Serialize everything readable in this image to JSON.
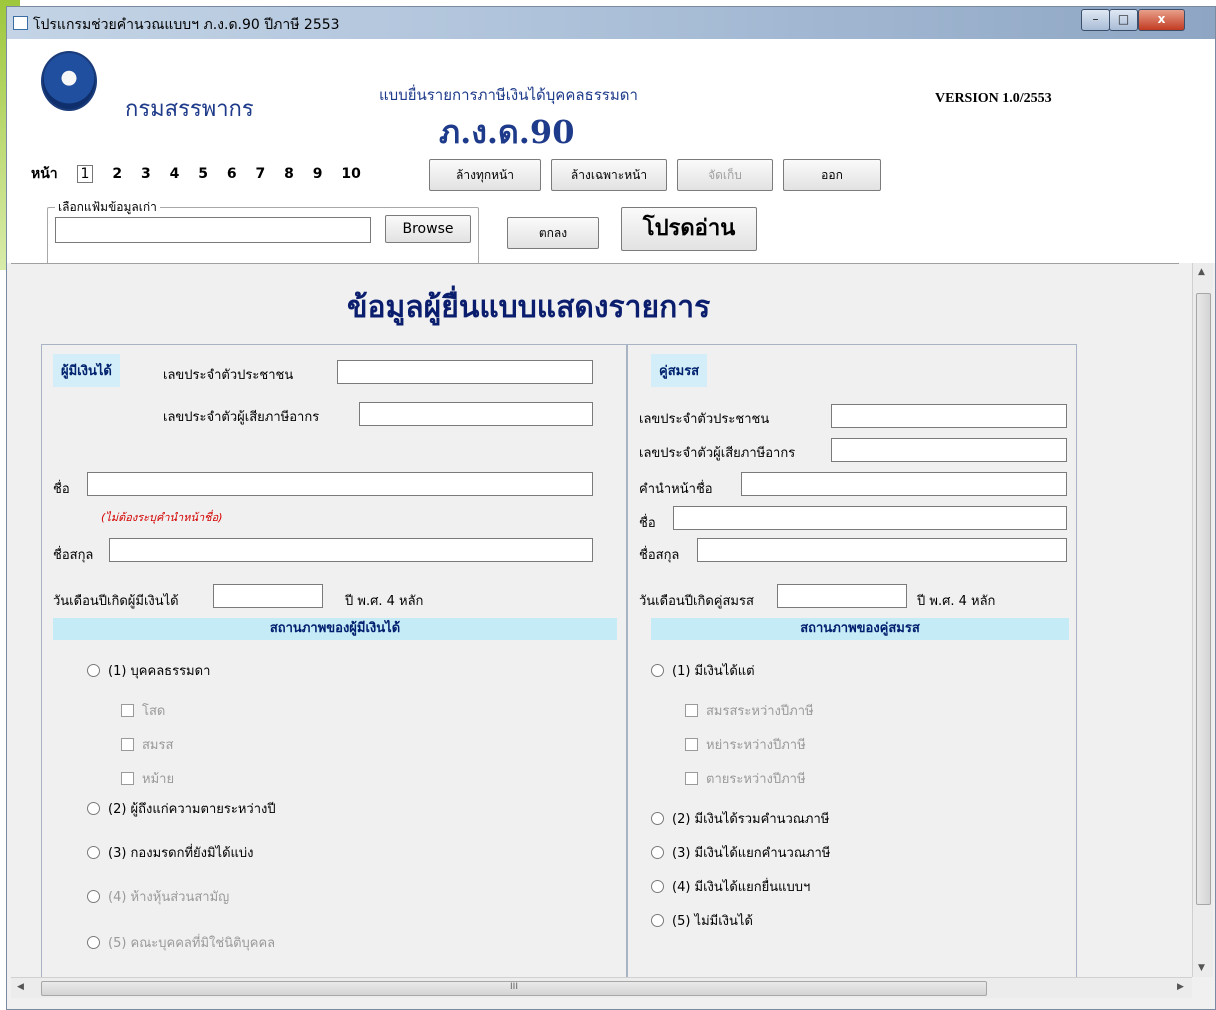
{
  "window": {
    "title": "โปรแกรมช่วยคำนวณแบบฯ ภ.ง.ด.90 ปีภาษี 2553",
    "minimize": "–",
    "maximize": "□",
    "close": "x"
  },
  "header": {
    "department": "กรมสรรพากร",
    "form_title": "แบบยื่นรายการภาษีเงินได้บุคคลธรรมดา",
    "form_code": "ภ.ง.ด.90",
    "version": "VERSION 1.0/2553"
  },
  "toolbar": {
    "page_label": "หน้า",
    "pages": [
      "1",
      "2",
      "3",
      "4",
      "5",
      "6",
      "7",
      "8",
      "9",
      "10"
    ],
    "clear_all": "ล้างทุกหน้า",
    "clear_page": "ล้างเฉพาะหน้า",
    "save": "จัดเก็บ",
    "exit": "ออก",
    "file_group_label": "เลือกแฟ้มข้อมูลเก่า",
    "browse": "Browse",
    "ok": "ตกลง",
    "please_read": "โปรดอ่าน"
  },
  "content": {
    "heading": "ข้อมูลผู้ยื่นแบบแสดงรายการ",
    "earner": {
      "tag": "ผู้มีเงินได้",
      "citizen_id": "เลขประจำตัวประชาชน",
      "tax_id": "เลขประจำตัวผู้เสียภาษีอากร",
      "name": "ชื่อ",
      "name_note": "(ไม่ต้องระบุคำนำหน้าชื่อ)",
      "surname": "ชื่อสกุล",
      "birthdate": "วันเดือนปีเกิดผู้มีเงินได้",
      "year_hint": "ปี พ.ศ. 4 หลัก",
      "status_title": "สถานภาพของผู้มีเงินได้",
      "status": [
        {
          "label": "(1) บุคคลธรรมดา",
          "enabled": true
        },
        {
          "label": "(2) ผู้ถึงแก่ความตายระหว่างปี",
          "enabled": true
        },
        {
          "label": "(3) กองมรดกที่ยังมิได้แบ่ง",
          "enabled": true
        },
        {
          "label": "(4) ห้างหุ้นส่วนสามัญ",
          "enabled": false
        },
        {
          "label": "(5) คณะบุคคลที่มิใช่นิติบุคคล",
          "enabled": false
        }
      ],
      "sub_status": [
        "โสด",
        "สมรส",
        "หม้าย"
      ]
    },
    "spouse": {
      "tag": "คู่สมรส",
      "citizen_id": "เลขประจำตัวประชาชน",
      "tax_id": "เลขประจำตัวผู้เสียภาษีอากร",
      "title": "คำนำหน้าชื่อ",
      "name": "ชื่อ",
      "surname": "ชื่อสกุล",
      "birthdate": "วันเดือนปีเกิดคู่สมรส",
      "year_hint": "ปี พ.ศ. 4 หลัก",
      "status_title": "สถานภาพของคู่สมรส",
      "status": [
        {
          "label": "(1) มีเงินได้แต่",
          "enabled": true
        },
        {
          "label": "(2) มีเงินได้รวมคำนวณภาษี",
          "enabled": true
        },
        {
          "label": "(3) มีเงินได้แยกคำนวณภาษี",
          "enabled": true
        },
        {
          "label": "(4) มีเงินได้แยกยื่นแบบฯ",
          "enabled": true
        },
        {
          "label": "(5) ไม่มีเงินได้",
          "enabled": true
        }
      ],
      "sub_status": [
        "สมรสระหว่างปีภาษี",
        "หย่าระหว่างปีภาษี",
        "ตายระหว่างปีภาษี"
      ]
    }
  },
  "scroll": {
    "h_grip": "III"
  }
}
